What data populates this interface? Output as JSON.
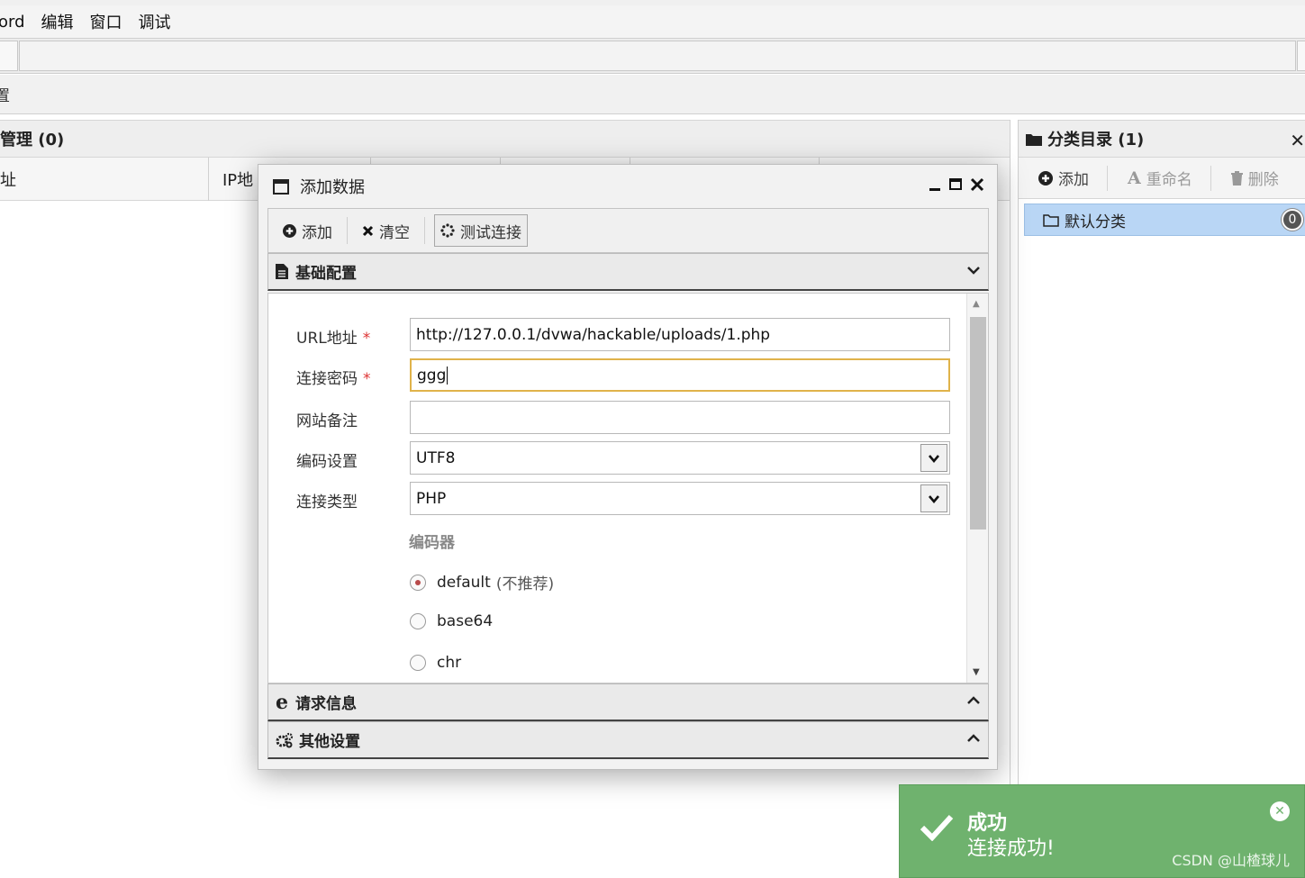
{
  "menubar": {
    "items": [
      "ord",
      "编辑",
      "窗口",
      "调试"
    ]
  },
  "toolbar2": {
    "text": "置"
  },
  "left_panel": {
    "title": "管理 (0)",
    "columns": [
      "址",
      "IP地"
    ]
  },
  "right_panel": {
    "title": "分类目录 (1)",
    "toolbar": {
      "add": "添加",
      "rename": "重命名",
      "delete": "删除"
    },
    "items": [
      {
        "label": "默认分类",
        "count": "0"
      }
    ]
  },
  "dialog": {
    "title": "添加数据",
    "toolbar": {
      "add": "添加",
      "clear": "清空",
      "test": "测试连接"
    },
    "sections": {
      "basic": "基础配置",
      "request": "请求信息",
      "other": "其他设置"
    },
    "form": {
      "url_label": "URL地址",
      "url_value": "http://127.0.0.1/dvwa/hackable/uploads/1.php",
      "password_label": "连接密码",
      "password_value": "ggg",
      "note_label": "网站备注",
      "note_value": "",
      "encoding_label": "编码设置",
      "encoding_value": "UTF8",
      "type_label": "连接类型",
      "type_value": "PHP",
      "encoder_title": "编码器",
      "encoders": [
        {
          "name": "default",
          "note": "(不推荐)",
          "checked": true
        },
        {
          "name": "base64",
          "note": "",
          "checked": false
        },
        {
          "name": "chr",
          "note": "",
          "checked": false
        }
      ],
      "required_mark": "*"
    }
  },
  "toast": {
    "title": "成功",
    "message": "连接成功!"
  },
  "watermark": "CSDN @山楂球儿",
  "colors": {
    "toast_bg": "#6fb26e",
    "selected_bg": "#b9d6f5",
    "focus_border": "#e0b34a",
    "required": "#dd3333"
  }
}
